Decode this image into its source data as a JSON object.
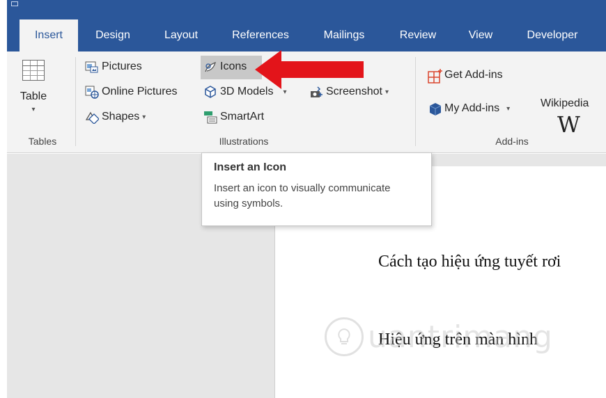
{
  "tabs": [
    {
      "label": "Insert",
      "active": true
    },
    {
      "label": "Design"
    },
    {
      "label": "Layout"
    },
    {
      "label": "References"
    },
    {
      "label": "Mailings"
    },
    {
      "label": "Review"
    },
    {
      "label": "View"
    },
    {
      "label": "Developer"
    }
  ],
  "ribbon": {
    "tables": {
      "table_label": "Table",
      "group_label": "Tables"
    },
    "illustrations": {
      "pictures": "Pictures",
      "online_pictures": "Online Pictures",
      "shapes": "Shapes",
      "icons": "Icons",
      "models_3d": "3D Models",
      "smartart": "SmartArt",
      "screenshot": "Screenshot",
      "group_label": "Illustrations"
    },
    "addins": {
      "get_addins": "Get Add-ins",
      "my_addins": "My Add-ins",
      "wikipedia_logo": "W",
      "wikipedia": "Wikipedia",
      "group_label": "Add-ins"
    }
  },
  "tooltip": {
    "title": "Insert an Icon",
    "description": "Insert an icon to visually communicate using symbols."
  },
  "document": {
    "line1": "Cách tạo hiệu ứng tuyết rơi",
    "line2": "Hiệu ứng trên màn hình"
  },
  "watermark": {
    "text": "uantrimang"
  },
  "colors": {
    "ribbon_tab_bg": "#2b579a",
    "ribbon_bg": "#f3f3f3",
    "arrow": "#e3141a"
  }
}
